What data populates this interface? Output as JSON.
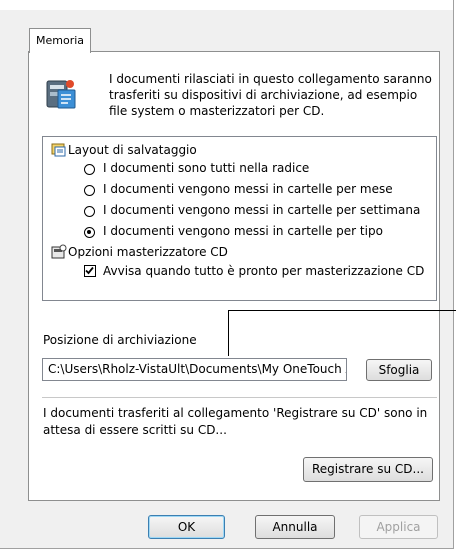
{
  "tab": {
    "label": "Memoria"
  },
  "intro": {
    "text": "I documenti rilasciati in questo collegamento saranno trasferiti su dispositivi di archiviazione, ad esempio file system o masterizzatori per CD.",
    "icon": "storage-device-icon"
  },
  "options": {
    "layout_category": "Layout di salvataggio",
    "layout_icon": "save-layout-icon",
    "radios": [
      {
        "label": "I documenti sono tutti nella radice",
        "selected": false
      },
      {
        "label": "I documenti vengono messi in cartelle per mese",
        "selected": false
      },
      {
        "label": "I documenti vengono messi in cartelle per settimana",
        "selected": false
      },
      {
        "label": "I documenti vengono messi in cartelle per tipo",
        "selected": true
      }
    ],
    "cd_category": "Opzioni masterizzatore CD",
    "cd_icon": "cd-burner-options-icon",
    "cd_checkbox": {
      "label": "Avvisa quando tutto è pronto per masterizzazione CD",
      "checked": true
    }
  },
  "storage": {
    "label": "Posizione di archiviazione",
    "path_value": "C:\\Users\\Rholz-VistaUlt\\Documents\\My OneTouch Archive",
    "browse_label": "Sfoglia"
  },
  "burn": {
    "info": "I documenti trasferiti al collegamento 'Registrare su CD' sono in attesa di essere scritti su CD...",
    "button_label": "Registrare su CD..."
  },
  "footer": {
    "ok_label": "OK",
    "cancel_label": "Annulla",
    "apply_label": "Applica"
  }
}
